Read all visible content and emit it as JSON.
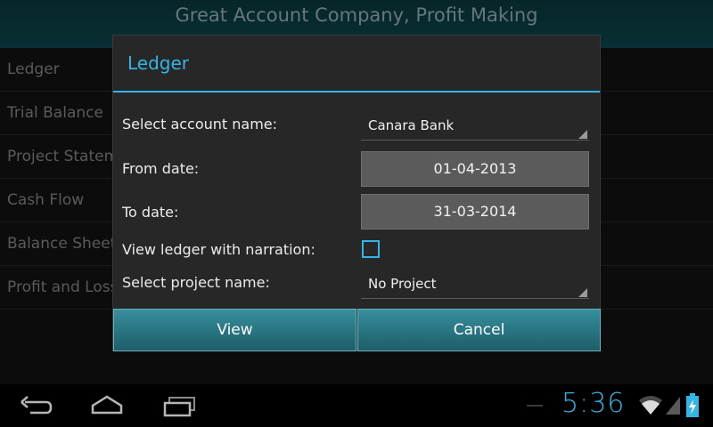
{
  "app": {
    "title": "Great Account Company, Profit Making",
    "subtitle": "",
    "menu": [
      "Ledger",
      "Trial Balance",
      "Project Statement",
      "Cash Flow",
      "Balance Sheet",
      "Profit and Loss"
    ]
  },
  "dialog": {
    "title": "Ledger",
    "account_label": "Select account name:",
    "account_value": "Canara Bank",
    "from_label": "From date:",
    "from_value": "01-04-2013",
    "to_label": "To date:",
    "to_value": "31-03-2014",
    "narration_label": "View ledger with narration:",
    "narration_checked": false,
    "project_label": "Select project name:",
    "project_value": "No Project",
    "view_button": "View",
    "cancel_button": "Cancel"
  },
  "statusbar": {
    "time": "5:36"
  },
  "colors": {
    "accent": "#33b5e5",
    "header": "#0d4a52",
    "button": "#2a7886"
  },
  "icons": [
    "back-icon",
    "home-icon",
    "recent-apps-icon",
    "wifi-icon",
    "signal-icon",
    "battery-icon"
  ]
}
